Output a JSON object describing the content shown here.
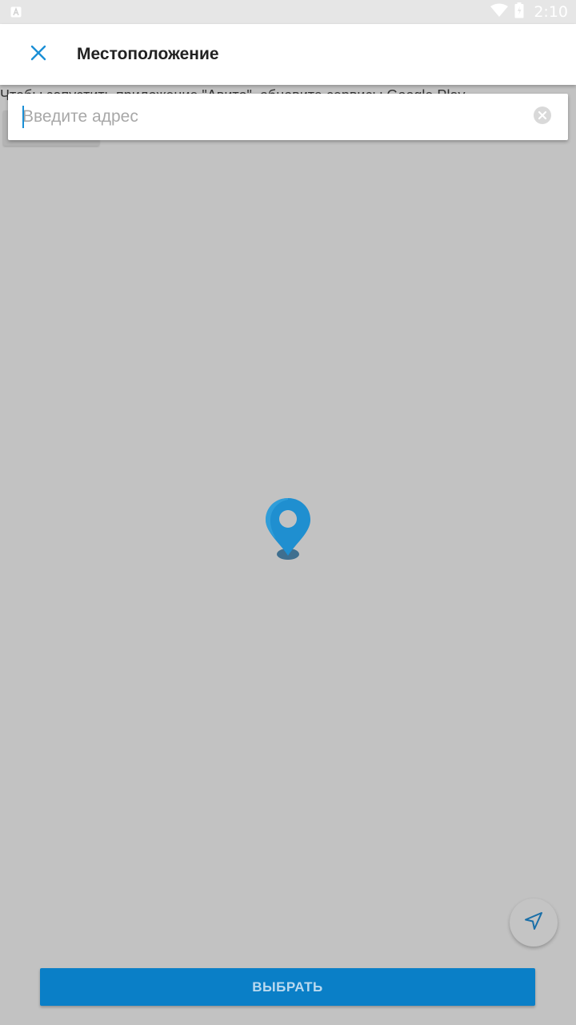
{
  "status_bar": {
    "time": "2:10",
    "icons": [
      "notification-a-icon",
      "wifi-icon",
      "battery-icon"
    ]
  },
  "header": {
    "title": "Местоположение",
    "close_icon": "close-icon"
  },
  "map": {
    "gps_message": "Чтобы запустить приложение \"Авито\", обновите сервисы Google Play."
  },
  "search": {
    "placeholder": "Введите адрес",
    "value": ""
  },
  "actions": {
    "select_label": "ВЫБРАТЬ"
  },
  "colors": {
    "accent": "#0a7fc7",
    "pin": "#1f8fd0",
    "map_background": "#c2c2c2"
  }
}
